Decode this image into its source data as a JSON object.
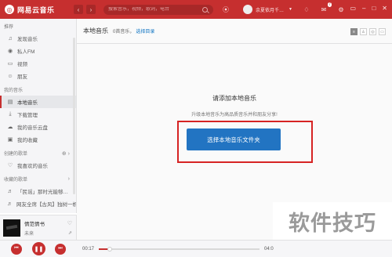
{
  "app": {
    "logo_text": "网易云音乐",
    "brand_color": "#c62f2f",
    "search_placeholder": "搜索音乐，视频，歌词，电台",
    "username": "余夏依月千…",
    "message_count": "7"
  },
  "sidebar": {
    "recommend_title": "推荐",
    "recommend_items": [
      {
        "icon": "music-note-icon",
        "label": "发现音乐"
      },
      {
        "icon": "radio-icon",
        "label": "私人FM"
      },
      {
        "icon": "video-icon",
        "label": "视频"
      },
      {
        "icon": "friends-icon",
        "label": "朋友"
      }
    ],
    "my_music_title": "我的音乐",
    "my_music_items": [
      {
        "icon": "local-music-icon",
        "label": "本地音乐",
        "active": true
      },
      {
        "icon": "download-icon",
        "label": "下载管理"
      },
      {
        "icon": "cloud-icon",
        "label": "我的音乐云盘"
      },
      {
        "icon": "collection-icon",
        "label": "我的收藏"
      }
    ],
    "created_title": "创建的歌单",
    "created_items": [
      {
        "icon": "heart-icon",
        "label": "我喜欢的音乐"
      }
    ],
    "collected_title": "收藏的歌单",
    "collected_items": [
      {
        "icon": "playlist-icon",
        "label": "「民谣」那时光能够…"
      },
      {
        "icon": "playlist-icon",
        "label": "网友全席【古风】独树一帜"
      }
    ]
  },
  "now_playing": {
    "title": "情范情书",
    "artist": "未来"
  },
  "main": {
    "title": "本地音乐",
    "count": "0首音乐，",
    "choose_link": "选择目录",
    "empty_title": "请添加本地音乐",
    "empty_sub": "升级本地音乐为高品质音乐并和朋友分享!",
    "cta_label": "选择本地音乐文件夹"
  },
  "player": {
    "current_time": "00:17",
    "total_time": "04:0",
    "progress": 0.07
  },
  "watermark": "软件技巧"
}
